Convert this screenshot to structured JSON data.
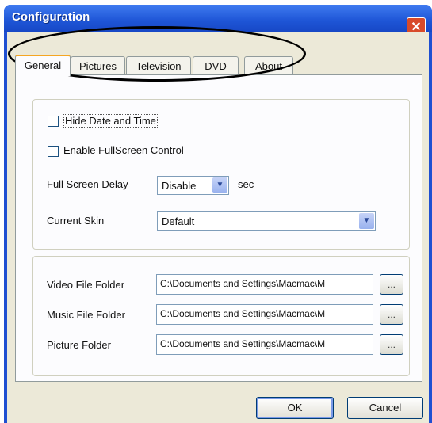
{
  "window": {
    "title": "Configuration",
    "close_glyph": "✕"
  },
  "tabs": [
    {
      "label": "General"
    },
    {
      "label": "Pictures"
    },
    {
      "label": "Television"
    },
    {
      "label": "DVD"
    },
    {
      "label": "About"
    }
  ],
  "general": {
    "hide_date_time_label": "Hide Date and Time",
    "enable_fullscreen_label": "Enable FullScreen Control",
    "fullscreen_delay_label": "Full Screen Delay",
    "fullscreen_delay_value": "Disable",
    "fullscreen_delay_unit": "sec",
    "current_skin_label": "Current Skin",
    "current_skin_value": "Default"
  },
  "folders": {
    "video_label": "Video File Folder",
    "video_value": "C:\\Documents and Settings\\Macmac\\M",
    "music_label": "Music File Folder",
    "music_value": "C:\\Documents and Settings\\Macmac\\M",
    "picture_label": "Picture Folder",
    "picture_value": "C:\\Documents and Settings\\Macmac\\M",
    "browse_label": "..."
  },
  "buttons": {
    "ok": "OK",
    "cancel": "Cancel"
  },
  "icons": {
    "dropdown": "chevron-down-icon",
    "close": "close-icon"
  },
  "colors": {
    "titlebar": "#1f4fd1",
    "dialog_bg": "#ece9d8",
    "active_tab_accent": "#f5a623"
  }
}
